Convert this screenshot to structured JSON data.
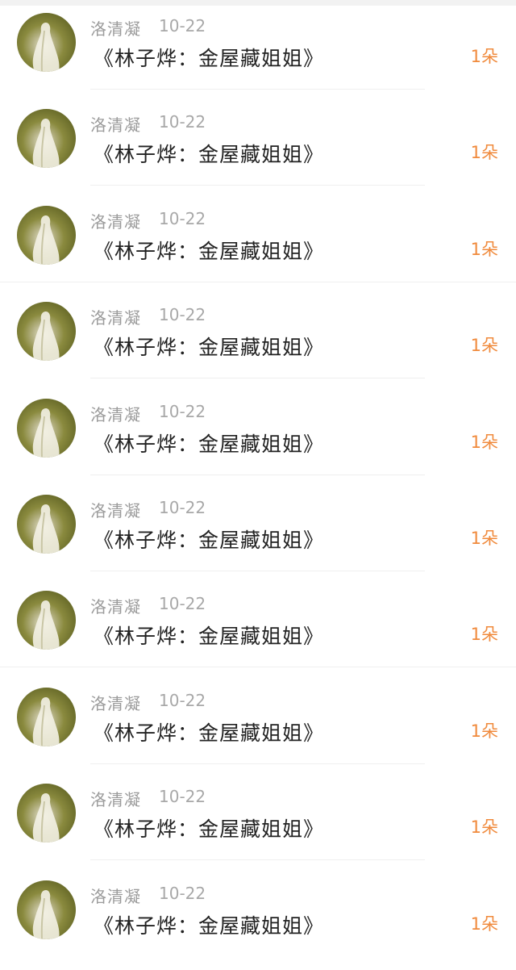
{
  "comments": [
    {
      "name": "洛清凝",
      "date": "10-22",
      "title": "《林子烨：金屋藏姐姐》",
      "gift": "1朵"
    },
    {
      "name": "洛清凝",
      "date": "10-22",
      "title": "《林子烨：金屋藏姐姐》",
      "gift": "1朵"
    },
    {
      "name": "洛清凝",
      "date": "10-22",
      "title": "《林子烨：金屋藏姐姐》",
      "gift": "1朵"
    },
    {
      "name": "洛清凝",
      "date": "10-22",
      "title": "《林子烨：金屋藏姐姐》",
      "gift": "1朵"
    },
    {
      "name": "洛清凝",
      "date": "10-22",
      "title": "《林子烨：金屋藏姐姐》",
      "gift": "1朵"
    },
    {
      "name": "洛清凝",
      "date": "10-22",
      "title": "《林子烨：金屋藏姐姐》",
      "gift": "1朵"
    },
    {
      "name": "洛清凝",
      "date": "10-22",
      "title": "《林子烨：金屋藏姐姐》",
      "gift": "1朵"
    },
    {
      "name": "洛清凝",
      "date": "10-22",
      "title": "《林子烨：金屋藏姐姐》",
      "gift": "1朵"
    },
    {
      "name": "洛清凝",
      "date": "10-22",
      "title": "《林子烨：金屋藏姐姐》",
      "gift": "1朵"
    },
    {
      "name": "洛清凝",
      "date": "10-22",
      "title": "《林子烨：金屋藏姐姐》",
      "gift": "1朵"
    }
  ],
  "colors": {
    "name": "#9b9b9b",
    "title": "#222222",
    "gift": "#f08a3c",
    "divider": "#efefef"
  },
  "icons": {
    "avatar": "avatar-photo"
  }
}
